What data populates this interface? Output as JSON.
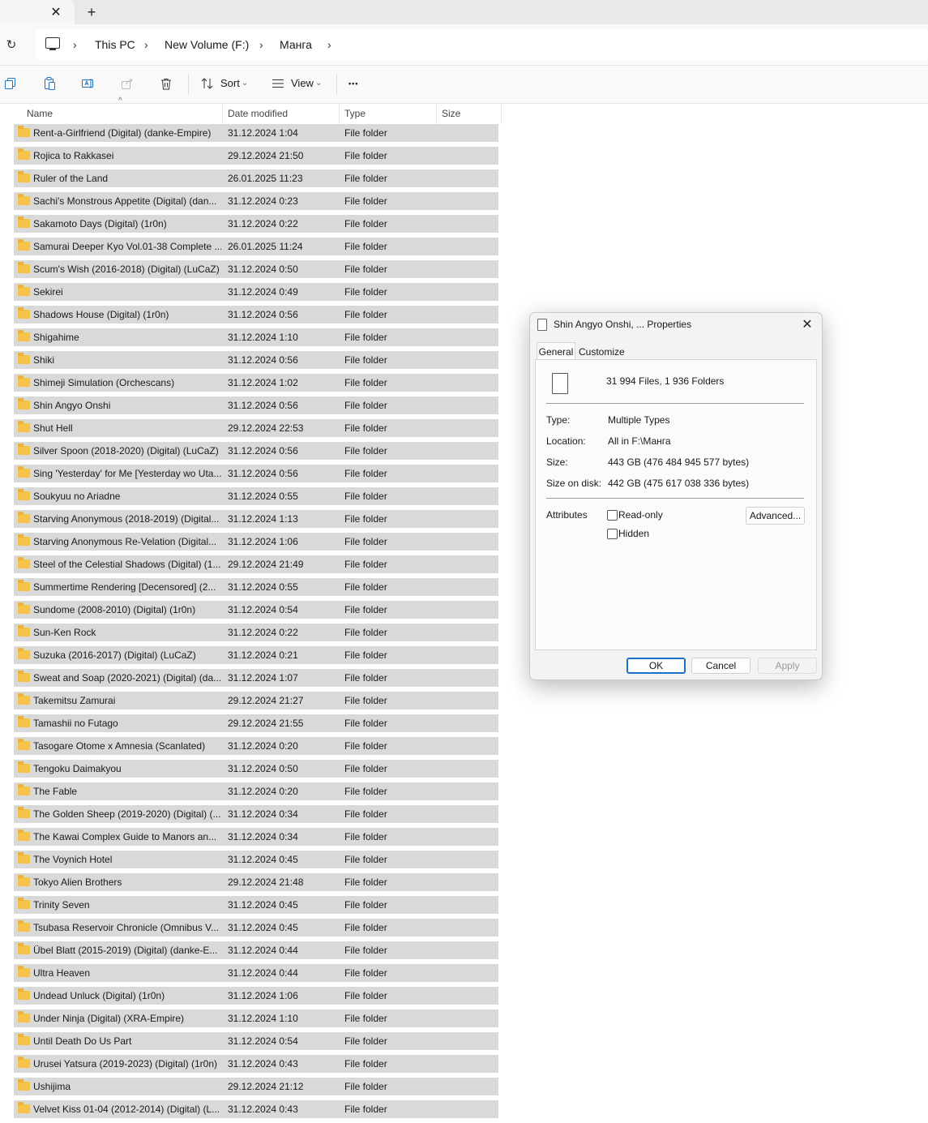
{
  "tabs": {
    "close": "✕",
    "new": "+"
  },
  "address": {
    "crumbs": [
      "This PC",
      "New Volume (F:)",
      "Манга"
    ],
    "refresh": "↻",
    "chevron": "›"
  },
  "toolbar": {
    "sort_label": "Sort",
    "view_label": "View",
    "more_label": "•••",
    "dropdown_caret": "⌄",
    "icons": [
      "copy-icon",
      "paste-icon",
      "rename-icon",
      "share-icon",
      "delete-icon",
      "sort-icon",
      "view-icon",
      "more-icon"
    ]
  },
  "columns": {
    "name": "Name",
    "date": "Date modified",
    "type": "Type",
    "size": "Size",
    "sort_indicator": "^"
  },
  "files": [
    {
      "name": "Rent-a-Girlfriend (Digital) (danke-Empire)",
      "date": "31.12.2024 1:04",
      "type": "File folder"
    },
    {
      "name": "Rojica to Rakkasei",
      "date": "29.12.2024 21:50",
      "type": "File folder"
    },
    {
      "name": "Ruler of the Land",
      "date": "26.01.2025 11:23",
      "type": "File folder"
    },
    {
      "name": "Sachi's Monstrous Appetite (Digital) (dan...",
      "date": "31.12.2024 0:23",
      "type": "File folder"
    },
    {
      "name": "Sakamoto Days (Digital) (1r0n)",
      "date": "31.12.2024 0:22",
      "type": "File folder"
    },
    {
      "name": "Samurai Deeper Kyo Vol.01-38 Complete ...",
      "date": "26.01.2025 11:24",
      "type": "File folder"
    },
    {
      "name": "Scum's Wish (2016-2018) (Digital) (LuCaZ)",
      "date": "31.12.2024 0:50",
      "type": "File folder"
    },
    {
      "name": "Sekirei",
      "date": "31.12.2024 0:49",
      "type": "File folder"
    },
    {
      "name": "Shadows House (Digital) (1r0n)",
      "date": "31.12.2024 0:56",
      "type": "File folder"
    },
    {
      "name": "Shigahime",
      "date": "31.12.2024 1:10",
      "type": "File folder"
    },
    {
      "name": "Shiki",
      "date": "31.12.2024 0:56",
      "type": "File folder"
    },
    {
      "name": "Shimeji Simulation (Orchescans)",
      "date": "31.12.2024 1:02",
      "type": "File folder"
    },
    {
      "name": "Shin Angyo Onshi",
      "date": "31.12.2024 0:56",
      "type": "File folder"
    },
    {
      "name": "Shut Hell",
      "date": "29.12.2024 22:53",
      "type": "File folder"
    },
    {
      "name": "Silver Spoon (2018-2020) (Digital) (LuCaZ)",
      "date": "31.12.2024 0:56",
      "type": "File folder"
    },
    {
      "name": "Sing 'Yesterday' for Me [Yesterday wo Uta...",
      "date": "31.12.2024 0:56",
      "type": "File folder"
    },
    {
      "name": "Soukyuu no Ariadne",
      "date": "31.12.2024 0:55",
      "type": "File folder"
    },
    {
      "name": "Starving Anonymous (2018-2019) (Digital...",
      "date": "31.12.2024 1:13",
      "type": "File folder"
    },
    {
      "name": "Starving Anonymous Re-Velation (Digital...",
      "date": "31.12.2024 1:06",
      "type": "File folder"
    },
    {
      "name": "Steel of the Celestial Shadows (Digital) (1...",
      "date": "29.12.2024 21:49",
      "type": "File folder"
    },
    {
      "name": "Summertime Rendering [Decensored] (2...",
      "date": "31.12.2024 0:55",
      "type": "File folder"
    },
    {
      "name": "Sundome (2008-2010) (Digital) (1r0n)",
      "date": "31.12.2024 0:54",
      "type": "File folder"
    },
    {
      "name": "Sun-Ken Rock",
      "date": "31.12.2024 0:22",
      "type": "File folder"
    },
    {
      "name": "Suzuka (2016-2017) (Digital) (LuCaZ)",
      "date": "31.12.2024 0:21",
      "type": "File folder"
    },
    {
      "name": "Sweat and Soap (2020-2021) (Digital) (da...",
      "date": "31.12.2024 1:07",
      "type": "File folder"
    },
    {
      "name": "Takemitsu Zamurai",
      "date": "29.12.2024 21:27",
      "type": "File folder"
    },
    {
      "name": "Tamashii no Futago",
      "date": "29.12.2024 21:55",
      "type": "File folder"
    },
    {
      "name": "Tasogare Otome x Amnesia (Scanlated)",
      "date": "31.12.2024 0:20",
      "type": "File folder"
    },
    {
      "name": "Tengoku Daimakyou",
      "date": "31.12.2024 0:50",
      "type": "File folder"
    },
    {
      "name": "The Fable",
      "date": "31.12.2024 0:20",
      "type": "File folder"
    },
    {
      "name": "The Golden Sheep (2019-2020) (Digital) (...",
      "date": "31.12.2024 0:34",
      "type": "File folder"
    },
    {
      "name": "The Kawai Complex Guide to Manors an...",
      "date": "31.12.2024 0:34",
      "type": "File folder"
    },
    {
      "name": "The Voynich Hotel",
      "date": "31.12.2024 0:45",
      "type": "File folder"
    },
    {
      "name": "Tokyo Alien Brothers",
      "date": "29.12.2024 21:48",
      "type": "File folder"
    },
    {
      "name": "Trinity Seven",
      "date": "31.12.2024 0:45",
      "type": "File folder"
    },
    {
      "name": "Tsubasa Reservoir Chronicle (Omnibus V...",
      "date": "31.12.2024 0:45",
      "type": "File folder"
    },
    {
      "name": "Übel Blatt (2015-2019) (Digital) (danke-E...",
      "date": "31.12.2024 0:44",
      "type": "File folder"
    },
    {
      "name": "Ultra Heaven",
      "date": "31.12.2024 0:44",
      "type": "File folder"
    },
    {
      "name": "Undead Unluck (Digital) (1r0n)",
      "date": "31.12.2024 1:06",
      "type": "File folder"
    },
    {
      "name": "Under Ninja (Digital) (XRA-Empire)",
      "date": "31.12.2024 1:10",
      "type": "File folder"
    },
    {
      "name": "Until Death Do Us Part",
      "date": "31.12.2024 0:54",
      "type": "File folder"
    },
    {
      "name": "Urusei Yatsura (2019-2023) (Digital) (1r0n)",
      "date": "31.12.2024 0:43",
      "type": "File folder"
    },
    {
      "name": "Ushijima",
      "date": "29.12.2024 21:12",
      "type": "File folder"
    },
    {
      "name": "Velvet Kiss 01-04 (2012-2014) (Digital) (L...",
      "date": "31.12.2024 0:43",
      "type": "File folder"
    }
  ],
  "dialog": {
    "title": "Shin Angyo Onshi, ... Properties",
    "close": "✕",
    "tab_general": "General",
    "tab_customize": "Customize",
    "summary": "31 994 Files,  1 936 Folders",
    "props": [
      {
        "label": "Type:",
        "value": "Multiple Types"
      },
      {
        "label": "Location:",
        "value": "All in F:\\Манга"
      },
      {
        "label": "Size:",
        "value": "443 GB (476 484 945 577 bytes)"
      },
      {
        "label": "Size on disk:",
        "value": "442 GB (475 617 038 336 bytes)"
      }
    ],
    "attributes_label": "Attributes",
    "readonly_label": "Read-only",
    "hidden_label": "Hidden",
    "advanced_label": "Advanced...",
    "ok_label": "OK",
    "cancel_label": "Cancel",
    "apply_label": "Apply"
  }
}
